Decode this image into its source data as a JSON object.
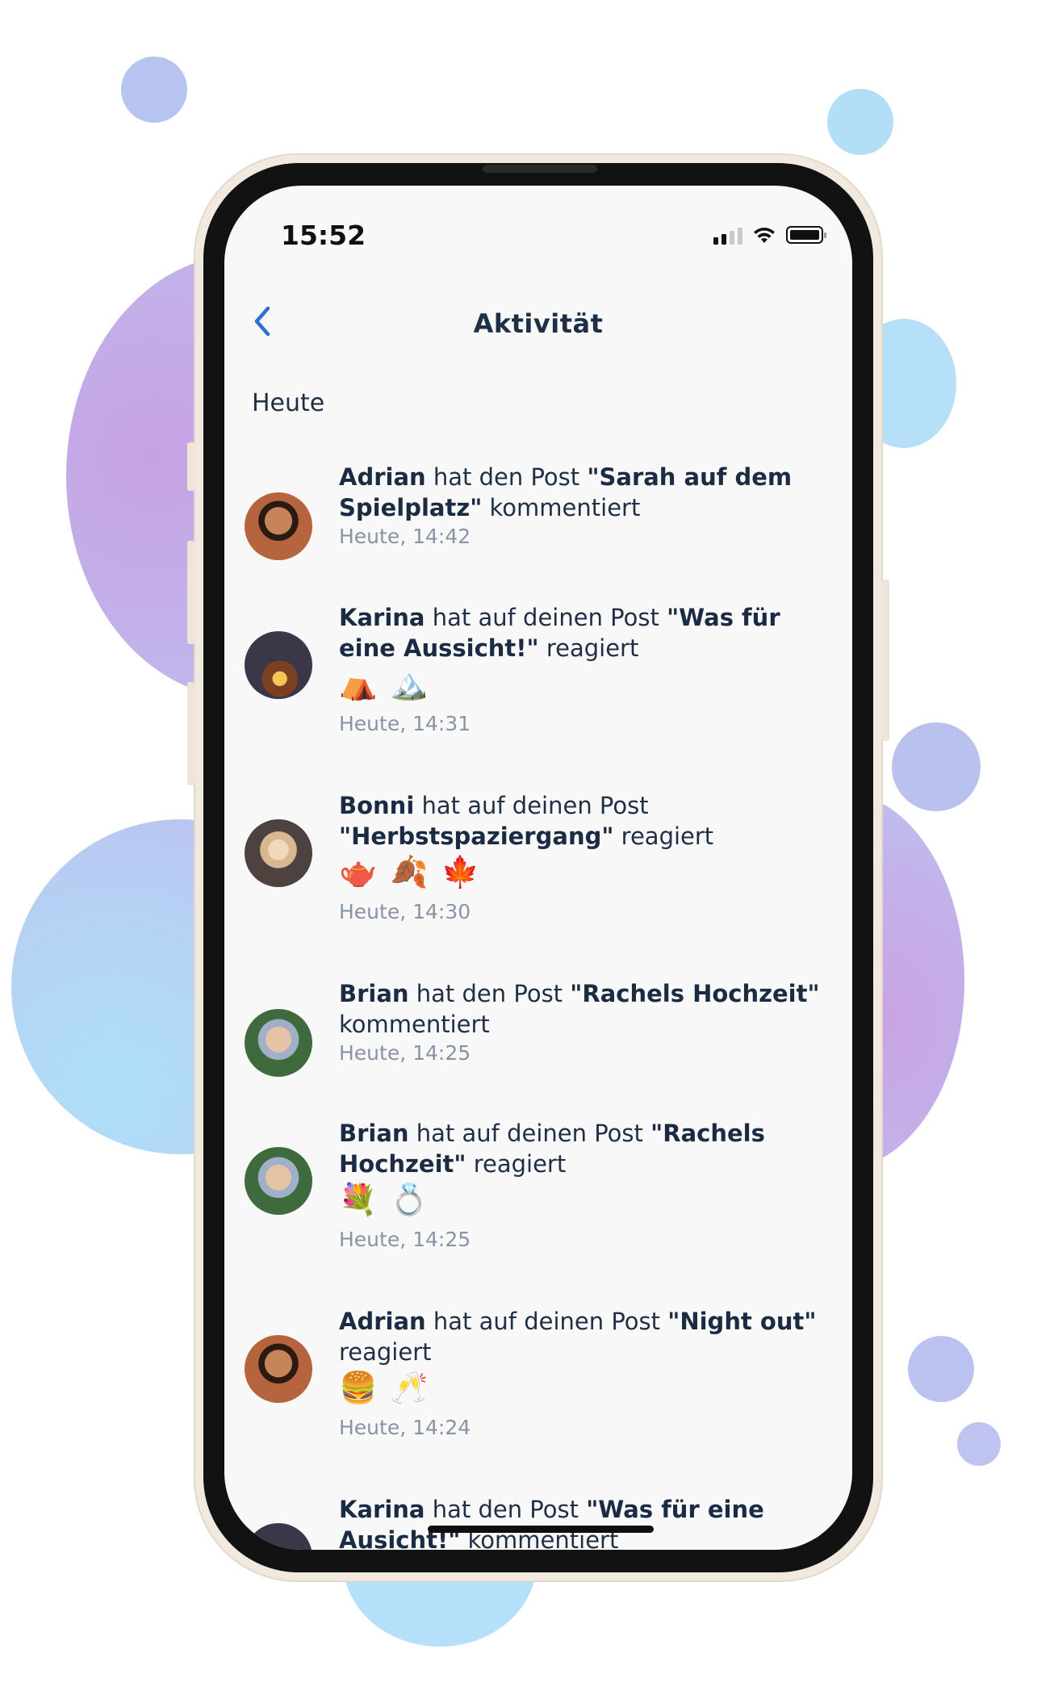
{
  "status_bar": {
    "time": "15:52"
  },
  "header": {
    "title": "Aktivität"
  },
  "section": {
    "heading": "Heute"
  },
  "activities": [
    {
      "user": "Adrian",
      "text_before": " hat den Post ",
      "post": "\"Sarah auf dem Spielplatz\"",
      "text_after": " kommentiert",
      "emojis": "",
      "time": "Heute, 14:42"
    },
    {
      "user": "Karina",
      "text_before": " hat auf deinen Post ",
      "post": "\"Was für eine Aussicht!\"",
      "text_after": " reagiert",
      "emojis": "⛺🏔️",
      "time": "Heute, 14:31"
    },
    {
      "user": "Bonni",
      "text_before": " hat auf deinen Post ",
      "post": "\"Herbstspaziergang\"",
      "text_after": " reagiert",
      "emojis": "🫖🍂🍁",
      "time": "Heute, 14:30"
    },
    {
      "user": "Brian",
      "text_before": " hat den Post ",
      "post": "\"Rachels Hochzeit\"",
      "text_after": " kommentiert",
      "emojis": "",
      "time": "Heute, 14:25"
    },
    {
      "user": "Brian",
      "text_before": " hat auf deinen Post ",
      "post": "\"Rachels Hochzeit\"",
      "text_after": " reagiert",
      "emojis": "💐💍",
      "time": "Heute, 14:25"
    },
    {
      "user": "Adrian",
      "text_before": " hat auf deinen Post ",
      "post": "\"Night out\"",
      "text_after": " reagiert",
      "emojis": "🍔🥂",
      "time": "Heute, 14:24"
    },
    {
      "user": "Karina",
      "text_before": " hat den Post ",
      "post": "\"Was für eine Ausicht!\"",
      "text_after": " kommentiert",
      "emojis": "",
      "time": ""
    }
  ],
  "colors": {
    "accent": "#2d6fdc",
    "text_primary": "#1f2f45",
    "text_secondary": "#8894a5",
    "screen_background": "#f8f8f8"
  }
}
